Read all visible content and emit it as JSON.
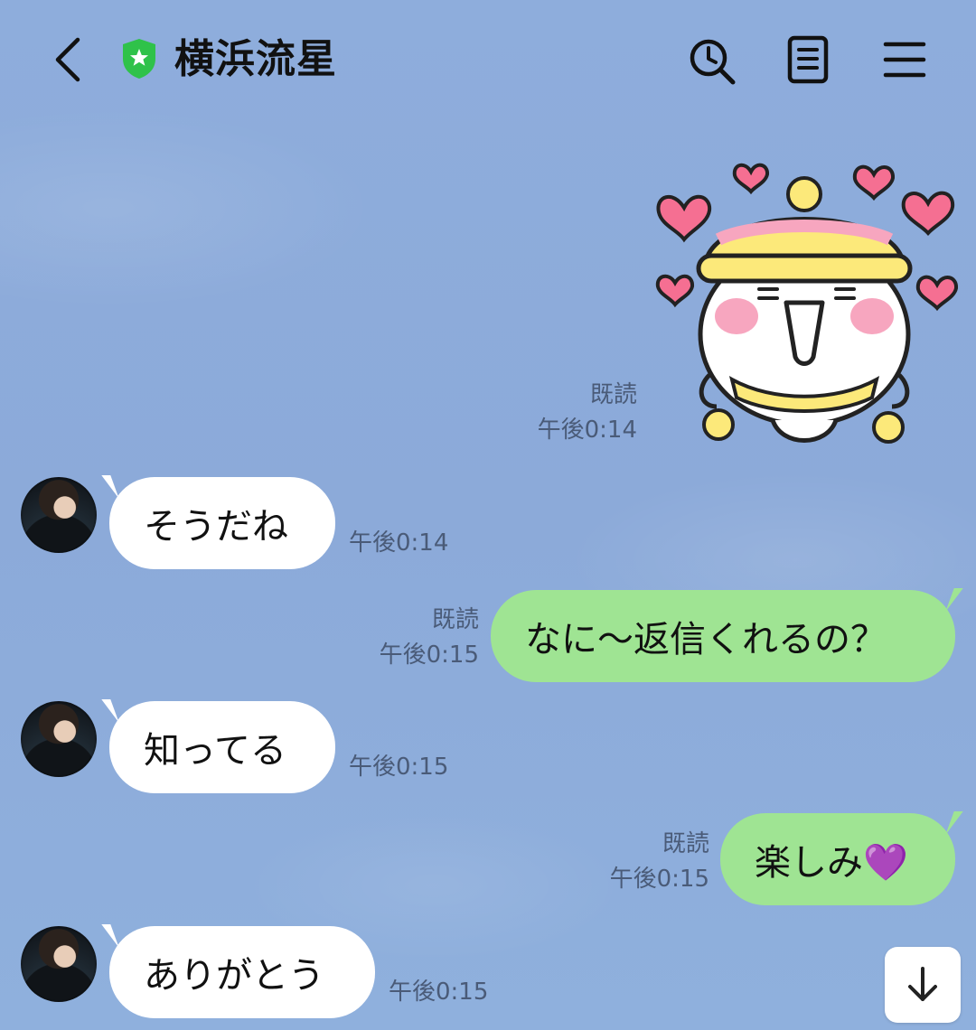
{
  "header": {
    "title": "横浜流星",
    "icons": [
      "back-icon",
      "verified-shield-icon",
      "search-history-icon",
      "notes-icon",
      "menu-icon"
    ]
  },
  "messages": [
    {
      "type": "sticker",
      "side": "out",
      "read": "既読",
      "time": "午後0:14",
      "sticker": "snowman-hearts"
    },
    {
      "type": "text",
      "side": "in",
      "text": "そうだね",
      "time": "午後0:14"
    },
    {
      "type": "text",
      "side": "out",
      "text": "なに〜返信くれるの？",
      "read": "既読",
      "time": "午後0:15"
    },
    {
      "type": "text",
      "side": "in",
      "text": "知ってる",
      "time": "午後0:15"
    },
    {
      "type": "text",
      "side": "out",
      "text": "楽しみ💜",
      "read": "既読",
      "time": "午後0:15"
    },
    {
      "type": "text",
      "side": "in",
      "text": "ありがとう",
      "time": "午後0:15"
    }
  ],
  "colors": {
    "background": "#8eacdb",
    "incoming_bubble": "#ffffff",
    "outgoing_bubble": "#9fe493",
    "shield": "#2fc24a"
  }
}
